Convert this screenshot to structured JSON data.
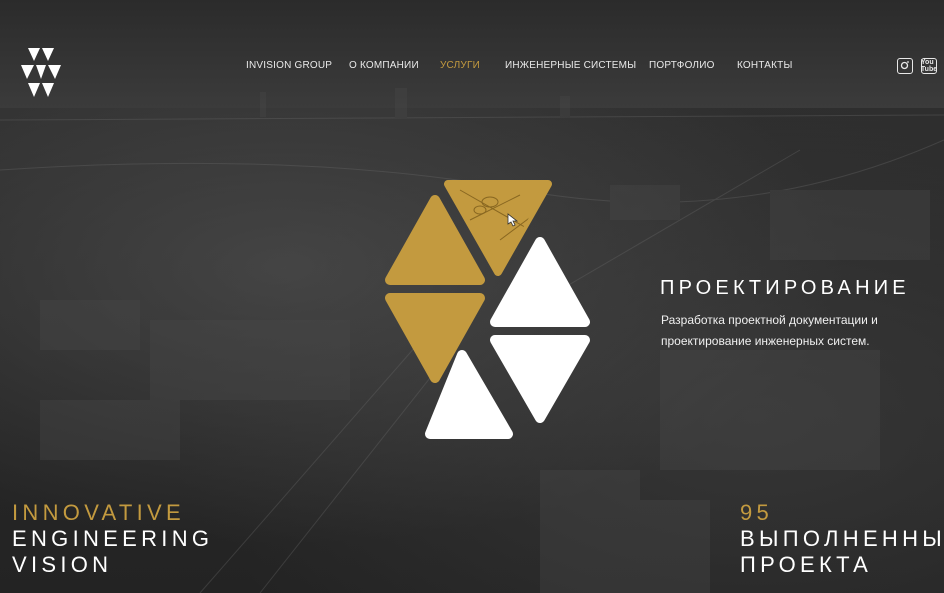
{
  "nav": {
    "items": [
      {
        "label": "INVISION GROUP",
        "active": false
      },
      {
        "label": "О КОМПАНИИ",
        "active": false
      },
      {
        "label": "УСЛУГИ",
        "active": true
      },
      {
        "label": "ИНЖЕНЕРНЫЕ СИСТЕМЫ",
        "active": false
      },
      {
        "label": "ПОРТФОЛИО",
        "active": false
      },
      {
        "label": "КОНТАКТЫ",
        "active": false
      }
    ]
  },
  "social": [
    {
      "icon": "instagram-icon"
    },
    {
      "icon": "youtube-icon",
      "text": "You Tube"
    }
  ],
  "service": {
    "title": "ПРОЕКТИРОВАНИЕ",
    "description": "Разработка проектной документации и проектирование инженерных систем."
  },
  "tagline": {
    "line1": "INNOVATIVE",
    "line2": "ENGINEERING",
    "line3": "VISION"
  },
  "stats": {
    "count": "95",
    "line1": "ВЫПОЛНЕННЫХ",
    "line2": "ПРОЕКТА"
  },
  "colors": {
    "accent": "#c39a3f",
    "text": "#ffffff",
    "background": "#2a2a2a"
  }
}
